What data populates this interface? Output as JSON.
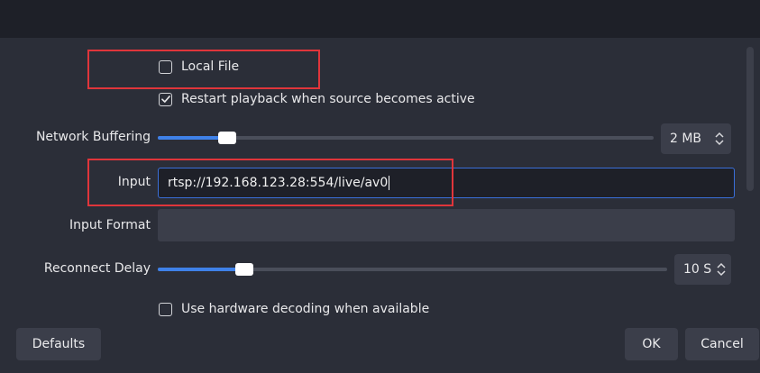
{
  "options": {
    "local_file_label": "Local File",
    "local_file_checked": false,
    "restart_label": "Restart playback when source becomes active",
    "restart_checked": true,
    "hw_decoding_label": "Use hardware decoding when available",
    "hw_decoding_checked": false
  },
  "network_buffering": {
    "label": "Network Buffering",
    "value": "2 MB",
    "slider_fraction": 0.14
  },
  "input": {
    "label": "Input",
    "value": "rtsp://192.168.123.28:554/live/av0"
  },
  "input_format": {
    "label": "Input Format",
    "value": ""
  },
  "reconnect_delay": {
    "label": "Reconnect Delay",
    "value": "10 S",
    "slider_fraction": 0.17
  },
  "buttons": {
    "defaults": "Defaults",
    "ok": "OK",
    "cancel": "Cancel"
  },
  "colors": {
    "accent": "#3f81e8",
    "highlight": "#e0353b",
    "background": "#2b2e38"
  }
}
